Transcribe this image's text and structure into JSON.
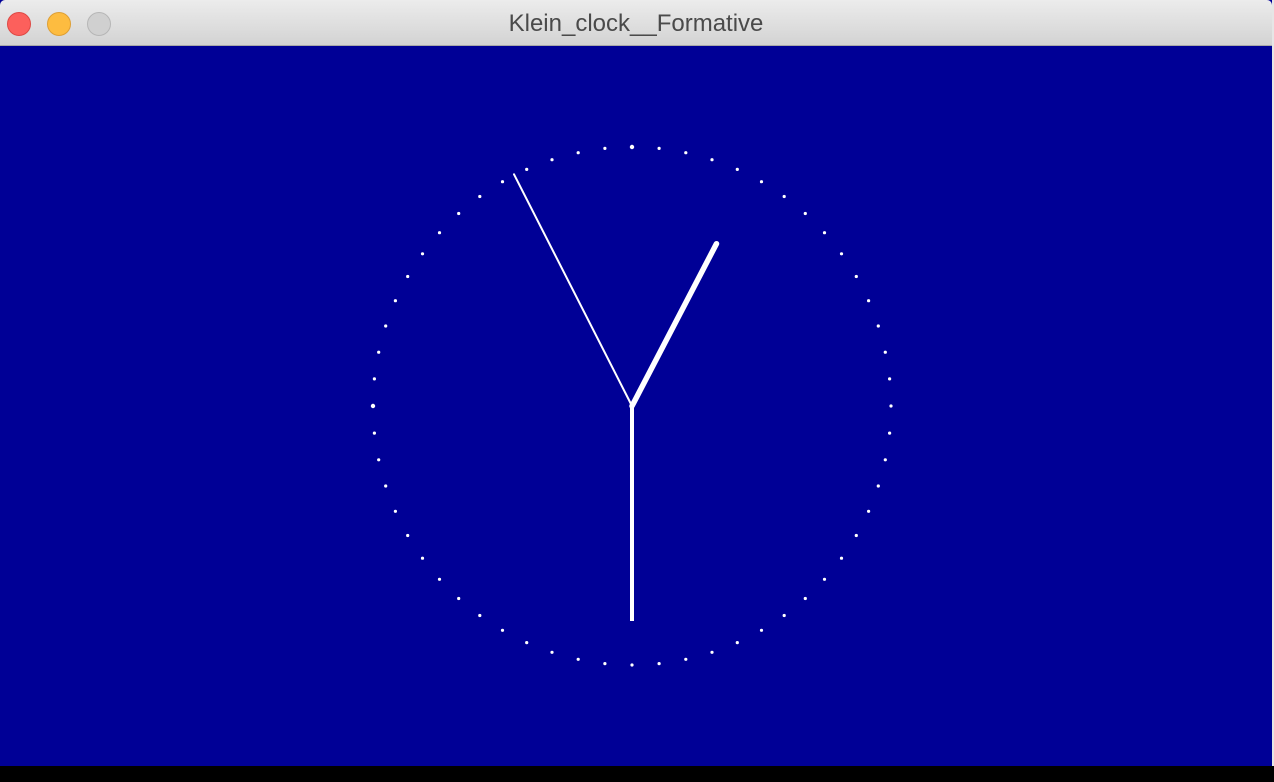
{
  "window": {
    "title": "Klein_clock__Formative",
    "background_color": "#000096"
  },
  "clock": {
    "time": {
      "hours": 0,
      "minutes": 55,
      "seconds": 30
    },
    "tick_count": 60,
    "tick_color": "#ffffff",
    "hand_color": "#ffffff"
  }
}
